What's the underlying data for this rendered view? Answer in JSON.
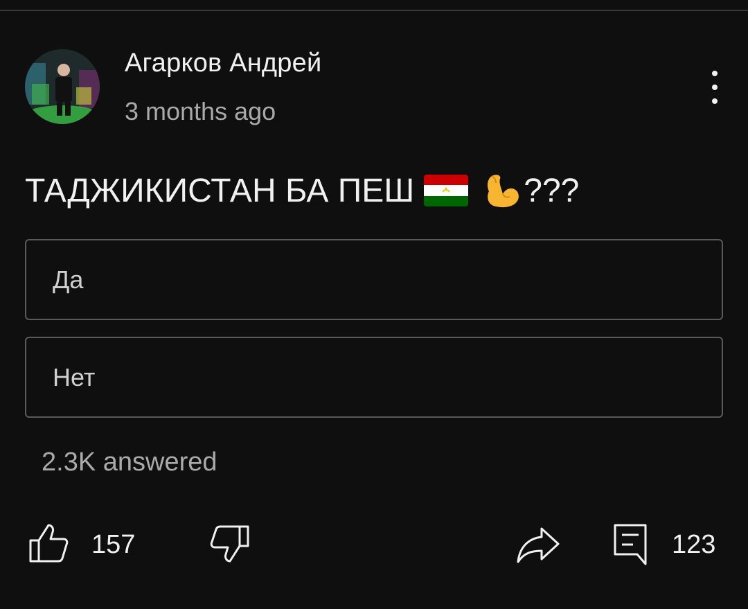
{
  "post": {
    "author": "Агарков Андрей",
    "time": "3 months ago",
    "text_before": "ТАДЖИКИСТАН БА ПЕШ",
    "text_after": "???",
    "flag_icon": "tajikistan-flag-icon",
    "emoji_icon": "flexed-biceps-icon"
  },
  "poll": {
    "options": [
      {
        "label": "Да"
      },
      {
        "label": "Нет"
      }
    ],
    "answered": "2.3K answered"
  },
  "actions": {
    "like_count": "157",
    "comment_count": "123"
  },
  "colors": {
    "background": "#0f0f0f",
    "text": "#f1f1f1",
    "muted": "#aaaaaa",
    "option_border": "#5a5a5a"
  }
}
